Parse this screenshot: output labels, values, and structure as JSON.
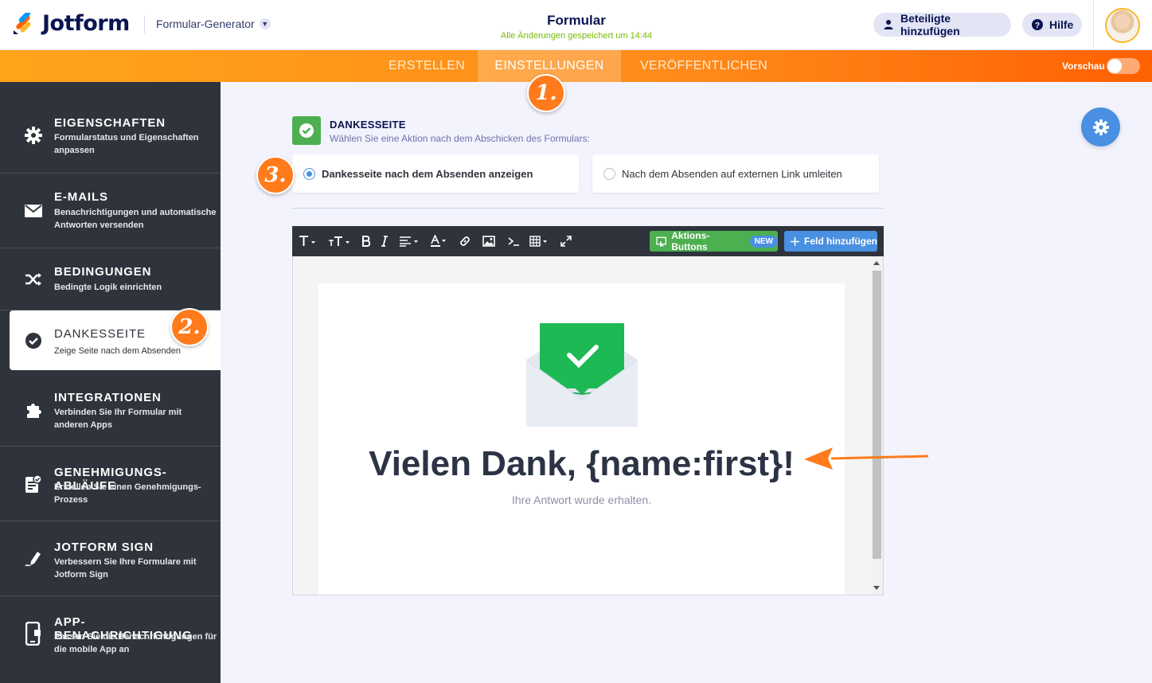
{
  "header": {
    "logo_text": "Jotform",
    "generator": "Formular-Generator",
    "title": "Formular",
    "saved_status": "Alle Änderungen gespeichert um 14:44",
    "collab_button": "Beteiligte hinzufügen",
    "help_button": "Hilfe"
  },
  "tabs": {
    "create": "ERSTELLEN",
    "settings": "EINSTELLUNGEN",
    "publish": "VERÖFFENTLICHEN",
    "preview": "Vorschau"
  },
  "badges": {
    "one": "1.",
    "two": "2.",
    "three": "3."
  },
  "sidebar": {
    "items": [
      {
        "title": "EIGENSCHAFTEN",
        "desc": "Formularstatus und Eigenschaften anpassen",
        "icon": "gear-icon"
      },
      {
        "title": "E-MAILS",
        "desc": "Benachrichtigungen und automatische Antworten versenden",
        "icon": "envelope-icon"
      },
      {
        "title": "BEDINGUNGEN",
        "desc": "Bedingte Logik einrichten",
        "icon": "shuffle-icon"
      },
      {
        "title": "DANKESSEITE",
        "desc": "Zeige Seite nach dem Absenden",
        "icon": "check-circle-icon"
      },
      {
        "title": "INTEGRATIONEN",
        "desc": "Verbinden Sie Ihr Formular mit anderen Apps",
        "icon": "puzzle-icon"
      },
      {
        "title": "GENEHMIGUNGS-ABLÄUFE",
        "desc": "Erstellen Sie einen Genehmigungs-Prozess",
        "icon": "approval-icon"
      },
      {
        "title": "JOTFORM SIGN",
        "desc": "Verbessern Sie Ihre Formulare mit Jotform Sign",
        "icon": "pen-icon"
      },
      {
        "title": "APP-BENACHRICHTIGUNG",
        "desc": "Passen Sie die Benachrichtigungen für die mobile App an",
        "icon": "mobile-icon"
      }
    ]
  },
  "main": {
    "section_title": "DANKESSEITE",
    "section_sub": "Wählen Sie eine Aktion nach dem Abschicken des Formulars:",
    "option_show": "Dankesseite nach dem Absenden anzeigen",
    "option_redirect": "Nach dem Absenden auf externen Link umleiten",
    "selected_option": "option_show"
  },
  "editor": {
    "action_buttons": "Aktions-Buttons",
    "new_badge": "NEW",
    "add_field": "Feld hinzufügen",
    "heading": "Vielen Dank, {name:first}!",
    "body": "Ihre Antwort wurde erhalten."
  },
  "colors": {
    "orange": "#ff7b1c",
    "sidebar": "#2f333b",
    "green": "#4caf50",
    "blue": "#4a90e2"
  }
}
